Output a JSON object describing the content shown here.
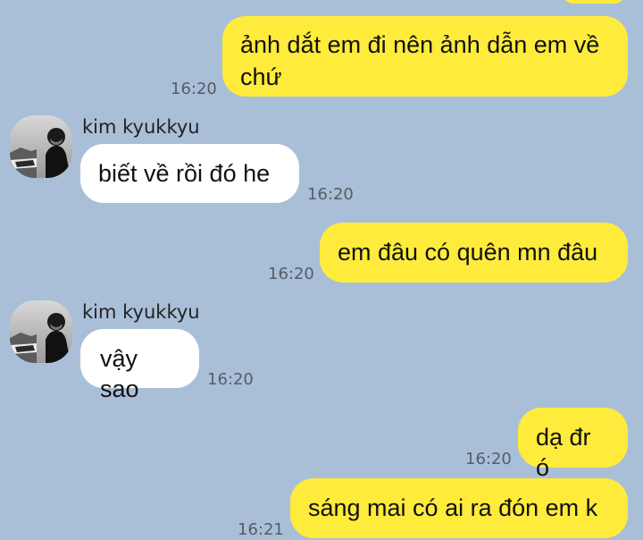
{
  "messages": [
    {
      "id": "m1",
      "text": "ảnh dắt em đi nên ảnh dẫn em về chứ",
      "time": "16:20"
    },
    {
      "id": "m2",
      "sender": "kim kyukkyu",
      "text": "biết về rồi đó he",
      "time": "16:20"
    },
    {
      "id": "m3",
      "text": "em đâu có quên mn đâu",
      "time": "16:20"
    },
    {
      "id": "m4",
      "sender": "kim kyukkyu",
      "text": "vậy sao",
      "time": "16:20"
    },
    {
      "id": "m5",
      "text": "dạ đr ó",
      "time": "16:20"
    },
    {
      "id": "m6",
      "text": "sáng mai có ai ra đón em k",
      "time": "16:21"
    }
  ],
  "colors": {
    "background": "#a9bfd8",
    "outgoing_bubble": "#ffeb3b",
    "incoming_bubble": "#ffffff"
  },
  "icons": {
    "avatar": "avatar-photo"
  }
}
